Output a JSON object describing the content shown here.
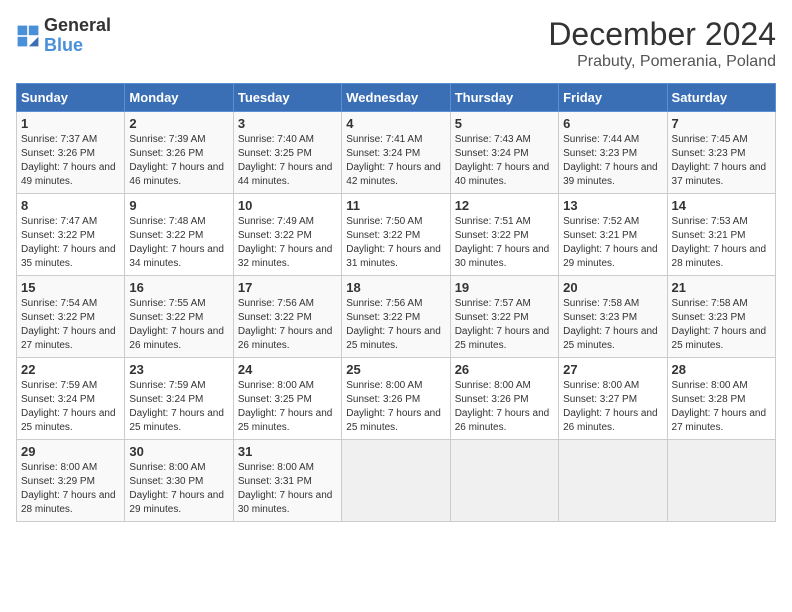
{
  "logo": {
    "line1": "General",
    "line2": "Blue"
  },
  "title": "December 2024",
  "subtitle": "Prabuty, Pomerania, Poland",
  "days_header": [
    "Sunday",
    "Monday",
    "Tuesday",
    "Wednesday",
    "Thursday",
    "Friday",
    "Saturday"
  ],
  "weeks": [
    [
      {
        "day": "1",
        "sunrise": "7:37 AM",
        "sunset": "3:26 PM",
        "daylight": "7 hours and 49 minutes."
      },
      {
        "day": "2",
        "sunrise": "7:39 AM",
        "sunset": "3:26 PM",
        "daylight": "7 hours and 46 minutes."
      },
      {
        "day": "3",
        "sunrise": "7:40 AM",
        "sunset": "3:25 PM",
        "daylight": "7 hours and 44 minutes."
      },
      {
        "day": "4",
        "sunrise": "7:41 AM",
        "sunset": "3:24 PM",
        "daylight": "7 hours and 42 minutes."
      },
      {
        "day": "5",
        "sunrise": "7:43 AM",
        "sunset": "3:24 PM",
        "daylight": "7 hours and 40 minutes."
      },
      {
        "day": "6",
        "sunrise": "7:44 AM",
        "sunset": "3:23 PM",
        "daylight": "7 hours and 39 minutes."
      },
      {
        "day": "7",
        "sunrise": "7:45 AM",
        "sunset": "3:23 PM",
        "daylight": "7 hours and 37 minutes."
      }
    ],
    [
      {
        "day": "8",
        "sunrise": "7:47 AM",
        "sunset": "3:22 PM",
        "daylight": "7 hours and 35 minutes."
      },
      {
        "day": "9",
        "sunrise": "7:48 AM",
        "sunset": "3:22 PM",
        "daylight": "7 hours and 34 minutes."
      },
      {
        "day": "10",
        "sunrise": "7:49 AM",
        "sunset": "3:22 PM",
        "daylight": "7 hours and 32 minutes."
      },
      {
        "day": "11",
        "sunrise": "7:50 AM",
        "sunset": "3:22 PM",
        "daylight": "7 hours and 31 minutes."
      },
      {
        "day": "12",
        "sunrise": "7:51 AM",
        "sunset": "3:22 PM",
        "daylight": "7 hours and 30 minutes."
      },
      {
        "day": "13",
        "sunrise": "7:52 AM",
        "sunset": "3:21 PM",
        "daylight": "7 hours and 29 minutes."
      },
      {
        "day": "14",
        "sunrise": "7:53 AM",
        "sunset": "3:21 PM",
        "daylight": "7 hours and 28 minutes."
      }
    ],
    [
      {
        "day": "15",
        "sunrise": "7:54 AM",
        "sunset": "3:22 PM",
        "daylight": "7 hours and 27 minutes."
      },
      {
        "day": "16",
        "sunrise": "7:55 AM",
        "sunset": "3:22 PM",
        "daylight": "7 hours and 26 minutes."
      },
      {
        "day": "17",
        "sunrise": "7:56 AM",
        "sunset": "3:22 PM",
        "daylight": "7 hours and 26 minutes."
      },
      {
        "day": "18",
        "sunrise": "7:56 AM",
        "sunset": "3:22 PM",
        "daylight": "7 hours and 25 minutes."
      },
      {
        "day": "19",
        "sunrise": "7:57 AM",
        "sunset": "3:22 PM",
        "daylight": "7 hours and 25 minutes."
      },
      {
        "day": "20",
        "sunrise": "7:58 AM",
        "sunset": "3:23 PM",
        "daylight": "7 hours and 25 minutes."
      },
      {
        "day": "21",
        "sunrise": "7:58 AM",
        "sunset": "3:23 PM",
        "daylight": "7 hours and 25 minutes."
      }
    ],
    [
      {
        "day": "22",
        "sunrise": "7:59 AM",
        "sunset": "3:24 PM",
        "daylight": "7 hours and 25 minutes."
      },
      {
        "day": "23",
        "sunrise": "7:59 AM",
        "sunset": "3:24 PM",
        "daylight": "7 hours and 25 minutes."
      },
      {
        "day": "24",
        "sunrise": "8:00 AM",
        "sunset": "3:25 PM",
        "daylight": "7 hours and 25 minutes."
      },
      {
        "day": "25",
        "sunrise": "8:00 AM",
        "sunset": "3:26 PM",
        "daylight": "7 hours and 25 minutes."
      },
      {
        "day": "26",
        "sunrise": "8:00 AM",
        "sunset": "3:26 PM",
        "daylight": "7 hours and 26 minutes."
      },
      {
        "day": "27",
        "sunrise": "8:00 AM",
        "sunset": "3:27 PM",
        "daylight": "7 hours and 26 minutes."
      },
      {
        "day": "28",
        "sunrise": "8:00 AM",
        "sunset": "3:28 PM",
        "daylight": "7 hours and 27 minutes."
      }
    ],
    [
      {
        "day": "29",
        "sunrise": "8:00 AM",
        "sunset": "3:29 PM",
        "daylight": "7 hours and 28 minutes."
      },
      {
        "day": "30",
        "sunrise": "8:00 AM",
        "sunset": "3:30 PM",
        "daylight": "7 hours and 29 minutes."
      },
      {
        "day": "31",
        "sunrise": "8:00 AM",
        "sunset": "3:31 PM",
        "daylight": "7 hours and 30 minutes."
      },
      null,
      null,
      null,
      null
    ]
  ]
}
